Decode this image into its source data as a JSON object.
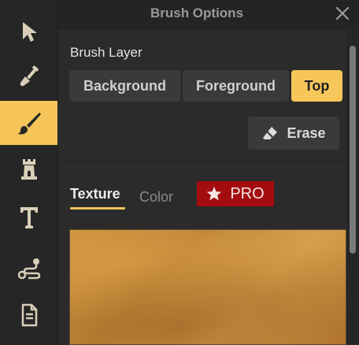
{
  "panel": {
    "title": "Brush Options"
  },
  "rail": {
    "items": [
      {
        "icon": "pointer-icon",
        "active": false
      },
      {
        "icon": "shovel-icon",
        "active": false
      },
      {
        "icon": "brush-icon",
        "active": true
      },
      {
        "icon": "tower-icon",
        "active": false
      },
      {
        "icon": "text-icon",
        "active": false
      },
      {
        "icon": "path-icon",
        "active": false
      },
      {
        "icon": "document-icon",
        "active": false
      }
    ]
  },
  "brush_layer": {
    "label": "Brush Layer",
    "options": [
      "Background",
      "Foreground",
      "Top"
    ],
    "selected": "Top"
  },
  "erase": {
    "label": "Erase"
  },
  "tabs": {
    "texture": "Texture",
    "color": "Color",
    "active": "Texture"
  },
  "pro_badge": {
    "label": "PRO"
  },
  "colors": {
    "accent": "#f6c65b",
    "pro": "#a40d10"
  }
}
